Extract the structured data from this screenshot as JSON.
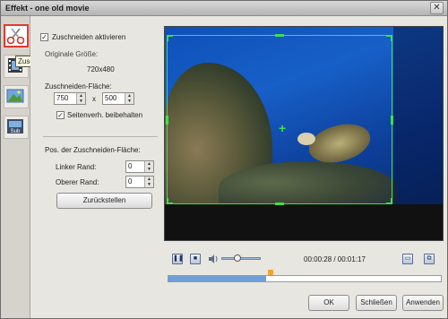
{
  "window": {
    "title": "Effekt - one old movie",
    "close_glyph": "✕"
  },
  "sidebar": {
    "tooltip": "Zuschneiden",
    "items": [
      {
        "icon": "scissors-icon",
        "glyph": "✂"
      },
      {
        "icon": "film-strip-icon",
        "glyph": "▦"
      },
      {
        "icon": "landscape-picture-icon",
        "glyph": "▲"
      },
      {
        "icon": "subtitle-icon",
        "glyph": "Sub"
      }
    ]
  },
  "crop": {
    "enable_label": "Zuschneiden aktivieren",
    "enable_checked": "✓",
    "original_size_label": "Originale Größe:",
    "original_size_value": "720x480",
    "area_label": "Zuschneiden-Fläche:",
    "width": "750",
    "times": "x",
    "height": "500",
    "keep_ratio_label": "Seitenverh. beibehalten",
    "keep_ratio_checked": "✓",
    "position_label": "Pos. der Zuschneiden-Fläche:",
    "left_label": "Linker Rand:",
    "left_value": "0",
    "top_label": "Oberer Rand:",
    "top_value": "0",
    "reset_button": "Zurückstellen"
  },
  "player": {
    "time": "00:00:28 / 00:01:17",
    "volume_fraction": 0.4,
    "progress_fraction": 0.36
  },
  "footer": {
    "ok": "OK",
    "close": "Schließen",
    "apply": "Anwenden"
  },
  "colors": {
    "crop_frame": "#3de04a",
    "active_tab_border": "#e03a2e",
    "accent": "#6f9fd6"
  }
}
